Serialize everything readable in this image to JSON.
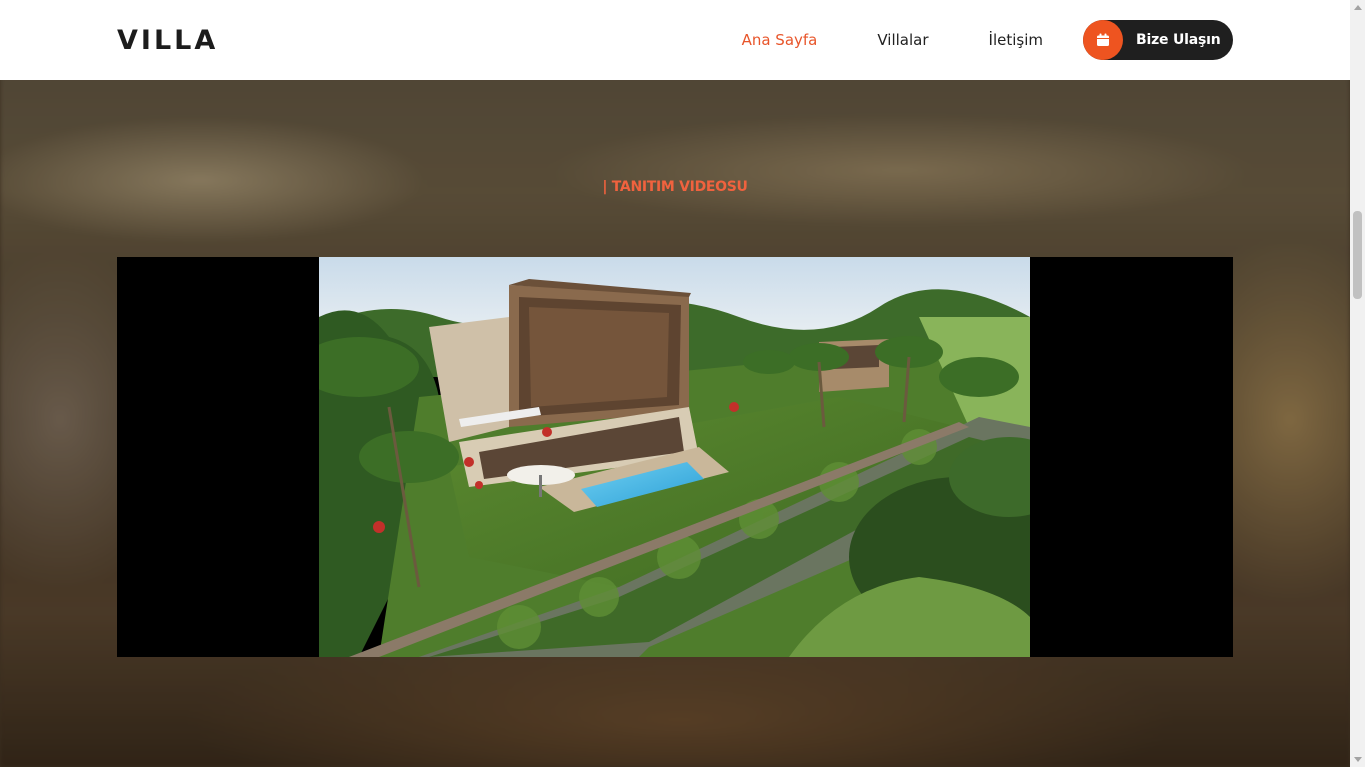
{
  "header": {
    "logo": "VILLA",
    "nav": [
      {
        "label": "Ana Sayfa",
        "active": true
      },
      {
        "label": "Villalar",
        "active": false
      },
      {
        "label": "İletişim",
        "active": false
      }
    ],
    "cta_label": "Bize Ulaşın",
    "cta_icon": "calendar-icon"
  },
  "section": {
    "title": "| TANITIM VIDEOSU"
  },
  "video": {
    "content": "villa-render-video-frame"
  },
  "colors": {
    "accent": "#ee5420",
    "title": "#f0623e",
    "cta_bg": "#1f1f1f",
    "header_bg": "#ffffff"
  }
}
